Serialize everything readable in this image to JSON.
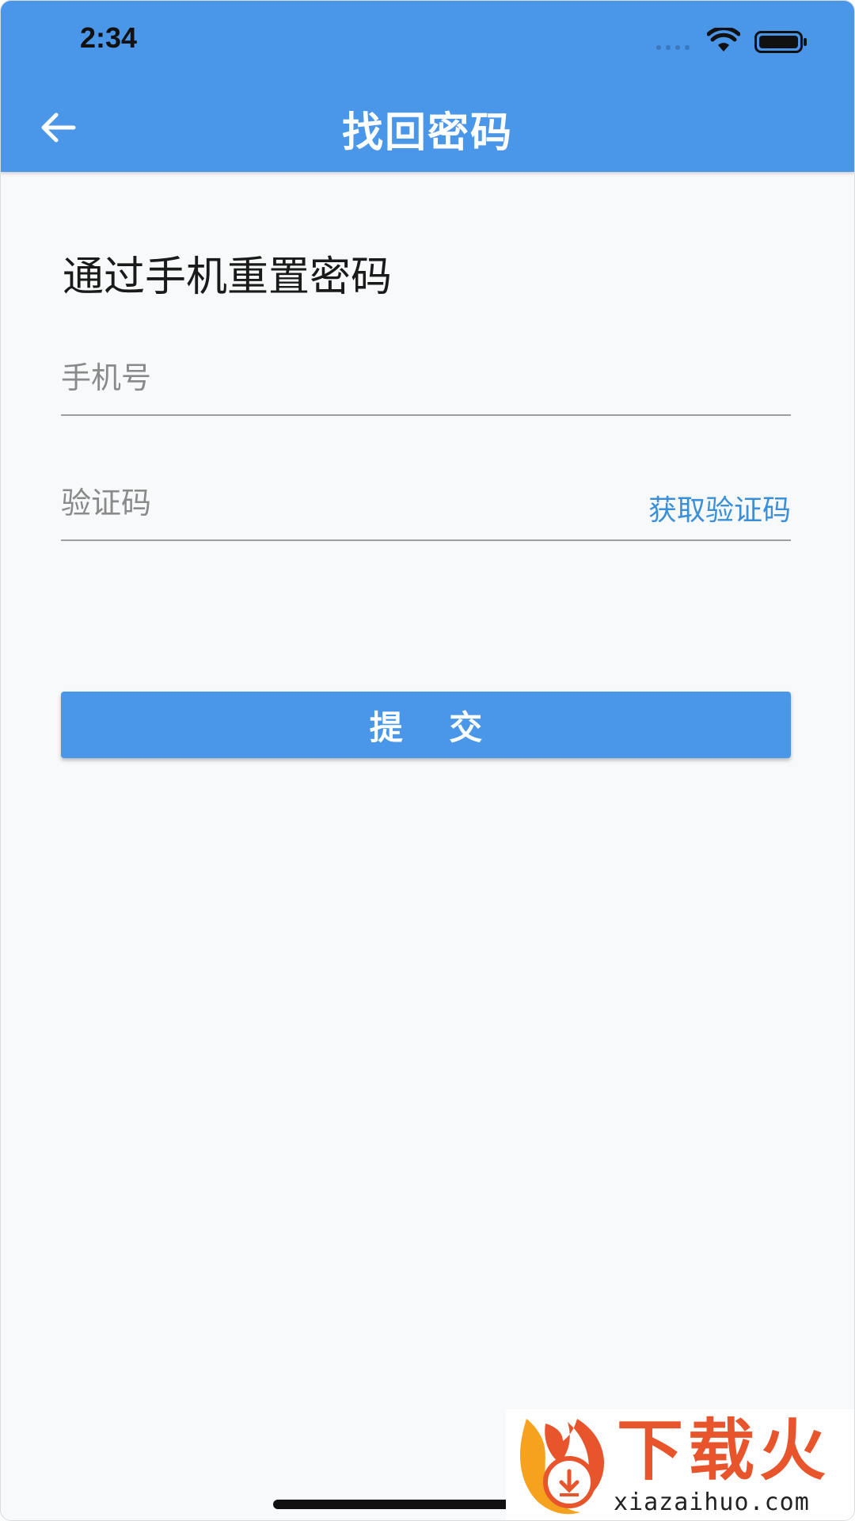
{
  "status_bar": {
    "time": "2:34"
  },
  "header": {
    "title": "找回密码",
    "back_icon": "arrow-left-icon"
  },
  "form": {
    "section_title": "通过手机重置密码",
    "phone_placeholder": "手机号",
    "phone_value": "",
    "code_placeholder": "验证码",
    "code_value": "",
    "get_code_label": "获取验证码",
    "submit_label": "提 交"
  },
  "watermark": {
    "brand_text": "下载火",
    "url_text": "xiazaihuo.com"
  },
  "colors": {
    "primary": "#4a96e8",
    "link": "#3a8fd9",
    "background": "#f8f9fa",
    "watermark_orange": "#e8542b"
  }
}
